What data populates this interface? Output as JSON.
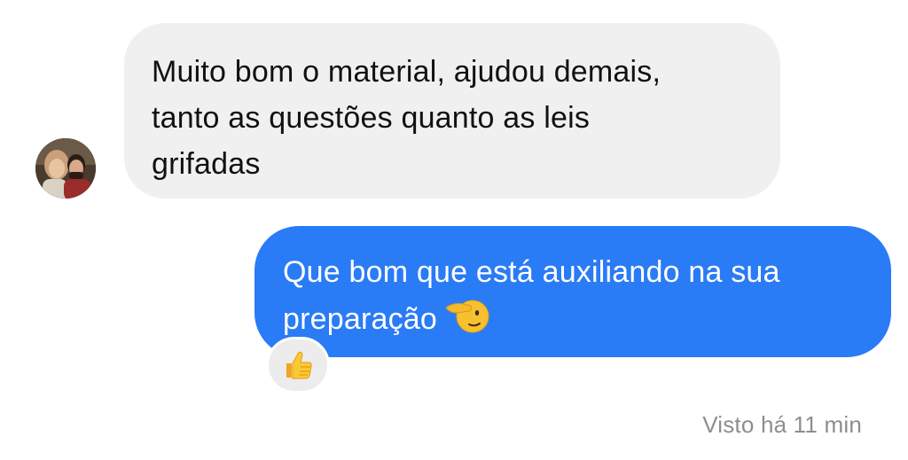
{
  "conversation": {
    "incoming": {
      "lines": [
        "Muito bom o material, ajudou demais,",
        "tanto as questões quanto as leis",
        "grifadas"
      ],
      "avatar_icon": "contact-avatar-photo",
      "bubble_color": "#f0f0f0"
    },
    "outgoing": {
      "lines": [
        "Que bom que está auxiliando na sua",
        "preparação"
      ],
      "emoji": "saluting-face",
      "bubble_color": "#2a7bf6",
      "reaction_icon": "thumbs-up"
    },
    "seen_status": "Visto há 11 min"
  }
}
